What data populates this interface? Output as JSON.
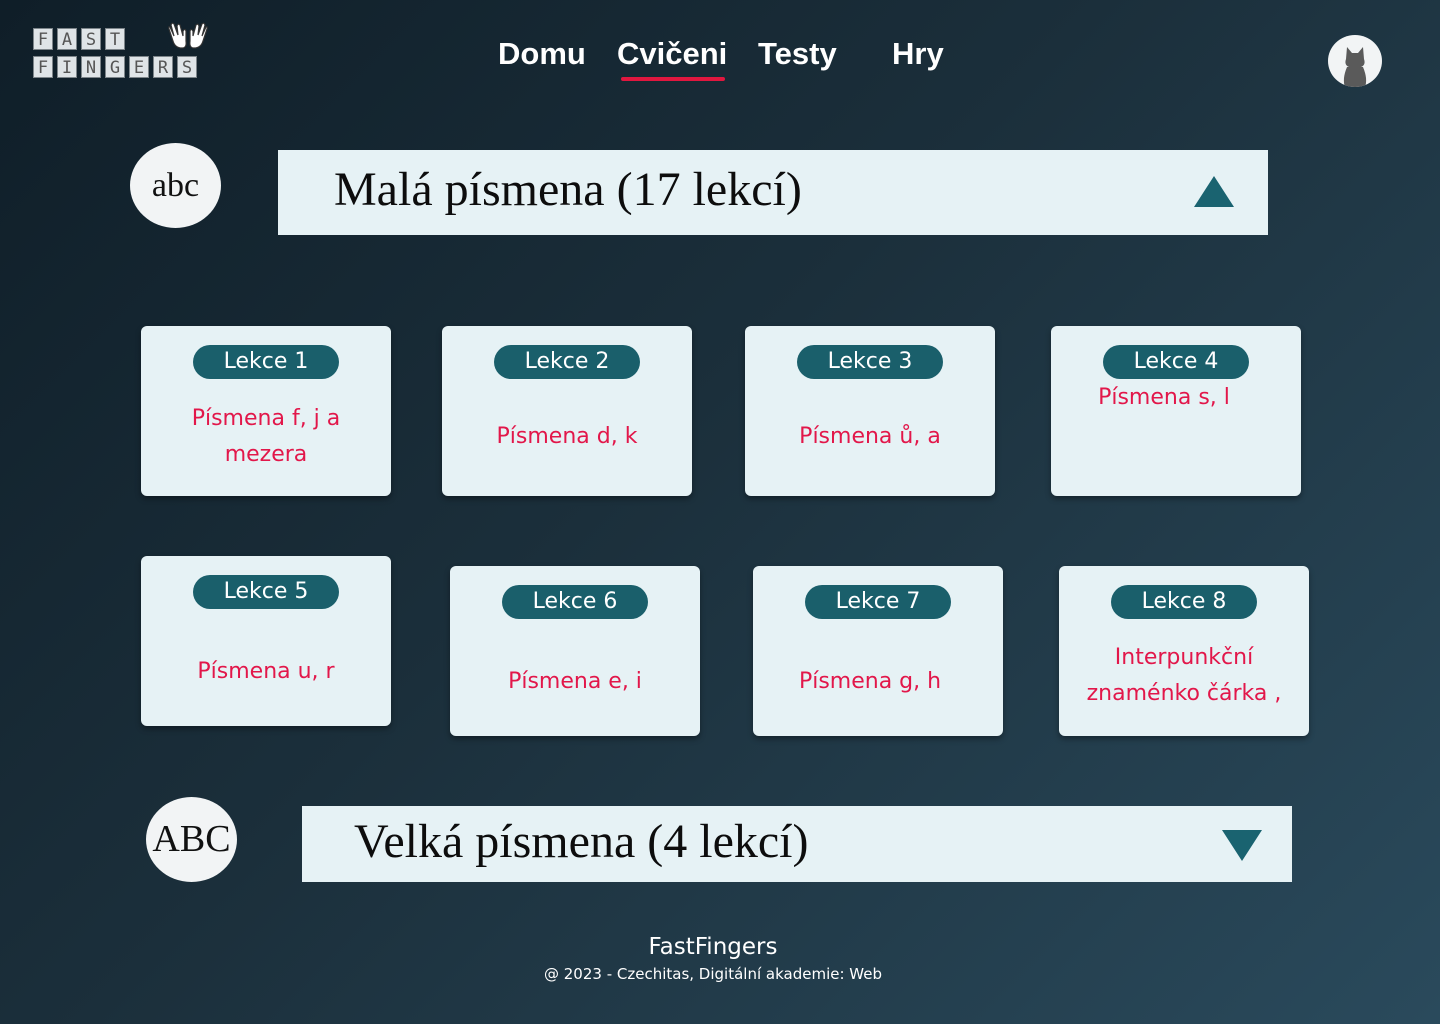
{
  "logo": {
    "row1": [
      "F",
      "A",
      "S",
      "T"
    ],
    "row2": [
      "F",
      "I",
      "N",
      "G",
      "E",
      "R",
      "S"
    ],
    "icon": "waving-hands-icon"
  },
  "nav": {
    "items": [
      "Domu",
      "Cvičeni",
      "Testy",
      "Hry"
    ],
    "active": "Cvičeni",
    "accent": "#e0173f"
  },
  "user": {
    "avatar_icon": "cat-avatar-icon"
  },
  "sections": [
    {
      "badge": "abc",
      "title": "Malá písmena (17 lekcí)",
      "state": "expanded",
      "toggle_icon": "triangle-up-icon"
    },
    {
      "badge": "ABC",
      "title": "Velká písmena (4 lekcí)",
      "state": "collapsed",
      "toggle_icon": "triangle-down-icon"
    }
  ],
  "lessons": [
    {
      "label": "Lekce 1",
      "desc": [
        "Písmena f, j a",
        "mezera"
      ]
    },
    {
      "label": "Lekce 2",
      "desc": [
        "Písmena d, k"
      ]
    },
    {
      "label": "Lekce 3",
      "desc": [
        "Písmena ů, a"
      ]
    },
    {
      "label": "Lekce 4",
      "desc": [
        "Písmena s, l"
      ]
    },
    {
      "label": "Lekce 5",
      "desc": [
        "Písmena u, r"
      ]
    },
    {
      "label": "Lekce 6",
      "desc": [
        "Písmena e, i"
      ]
    },
    {
      "label": "Lekce 7",
      "desc": [
        "Písmena g, h"
      ]
    },
    {
      "label": "Lekce 8",
      "desc": [
        "Interpunkční",
        "znaménko čárka ,"
      ]
    }
  ],
  "footer": {
    "title": "FastFingers",
    "subtitle": "@ 2023 - Czechitas, Digitální akademie: Web"
  },
  "colors": {
    "pill": "#1a5f6b",
    "lesson_text": "#e2174a",
    "card_bg": "#e6f2f5",
    "toggle": "#1a6370"
  }
}
